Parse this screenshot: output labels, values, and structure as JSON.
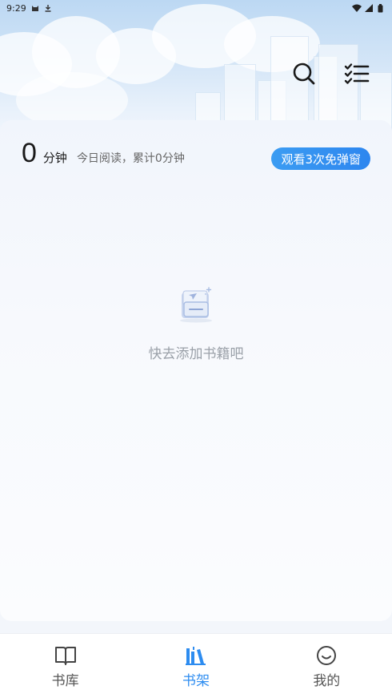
{
  "status_bar": {
    "time": "9:29"
  },
  "header": {
    "search_icon": "search-icon",
    "list_icon": "checklist-icon"
  },
  "reading": {
    "minutes": "0",
    "unit": "分钟",
    "summary": "今日阅读，累计0分钟",
    "promo_label": "观看3次免弹窗"
  },
  "empty": {
    "message": "快去添加书籍吧"
  },
  "bottom_nav": {
    "items": [
      {
        "label": "书库",
        "icon": "open-book-icon",
        "active": false
      },
      {
        "label": "书架",
        "icon": "bookshelf-icon",
        "active": true
      },
      {
        "label": "我的",
        "icon": "smiley-icon",
        "active": false
      }
    ]
  },
  "colors": {
    "accent": "#2d8cf0",
    "promo_bg": "#3b9cf2"
  }
}
